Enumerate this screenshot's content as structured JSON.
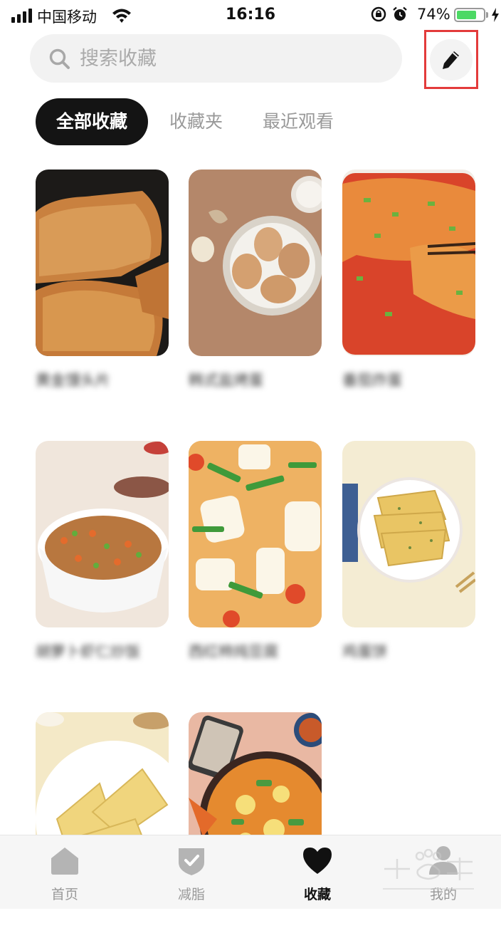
{
  "status_bar": {
    "carrier": "中国移动",
    "time": "16:16",
    "battery": "74%",
    "battery_level": 0.74
  },
  "search": {
    "placeholder": "搜索收藏"
  },
  "tabs": [
    {
      "label": "全部收藏",
      "active": true
    },
    {
      "label": "收藏夹",
      "active": false
    },
    {
      "label": "最近观看",
      "active": false
    }
  ],
  "recipes": [
    {
      "title": "黄金馒头片",
      "image": "toast-slices"
    },
    {
      "title": "韩式盐烤蛋",
      "image": "baked-eggs"
    },
    {
      "title": "番茄炸蛋",
      "image": "tomato-egg"
    },
    {
      "title": "胡萝卜虾仁炒饭",
      "image": "fried-rice"
    },
    {
      "title": "西红柿炖豆腐",
      "image": "tofu-soup"
    },
    {
      "title": "鸡蛋饼",
      "image": "egg-pancake"
    },
    {
      "title": "",
      "image": "pancake-plate"
    },
    {
      "title": "",
      "image": "noodle-pot"
    }
  ],
  "tab_bar": [
    {
      "label": "首页",
      "icon": "home-icon",
      "active": false
    },
    {
      "label": "减脂",
      "icon": "shield-check-icon",
      "active": false
    },
    {
      "label": "收藏",
      "icon": "heart-icon",
      "active": true
    },
    {
      "label": "我的",
      "icon": "user-icon",
      "active": false
    }
  ],
  "colors": {
    "accent_dark": "#141414",
    "highlight_box": "#e33b3b",
    "battery_green": "#4cd964"
  }
}
